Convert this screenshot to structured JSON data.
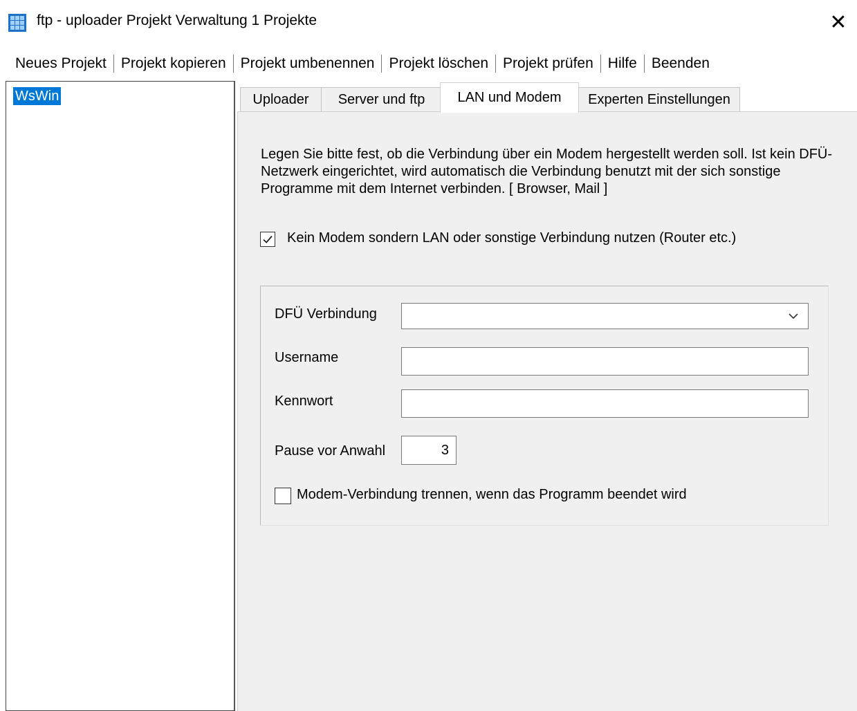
{
  "window": {
    "title": "ftp - uploader Projekt Verwaltung 1 Projekte",
    "icon": "grid-app-icon",
    "close_glyph": "✕"
  },
  "menu": {
    "items": [
      "Neues Projekt",
      "Projekt kopieren",
      "Projekt umbenennen",
      "Projekt löschen",
      "Projekt prüfen",
      "Hilfe",
      "Beenden"
    ]
  },
  "projects": {
    "items": [
      "WsWin"
    ],
    "selected": "WsWin"
  },
  "tabs": {
    "items": [
      "Uploader",
      "Server und ftp",
      "LAN und Modem",
      "Experten Einstellungen"
    ],
    "active": "LAN und Modem"
  },
  "lan_panel": {
    "description": "Legen Sie bitte fest, ob die Verbindung über ein Modem hergestellt werden soll. Ist kein DFÜ-Netzwerk eingerichtet, wird automatisch die Verbindung benutzt mit der sich sonstige Programme mit dem Internet verbinden. [ Browser, Mail ]",
    "lan_checkbox": {
      "label": "Kein Modem sondern LAN oder sonstige Verbindung nutzen (Router etc.)",
      "checked": true
    },
    "dfu": {
      "label": "DFÜ Verbindung",
      "value": ""
    },
    "username": {
      "label": "Username",
      "value": ""
    },
    "password": {
      "label": "Kennwort",
      "value": ""
    },
    "pause": {
      "label": "Pause vor Anwahl",
      "value": "3"
    },
    "modem_checkbox": {
      "label": "Modem-Verbindung trennen, wenn das Programm beendet wird",
      "checked": false
    }
  },
  "colors": {
    "selection": "#0078d7",
    "panel_bg": "#f0f0f0",
    "app_icon": "#1e70c8"
  }
}
